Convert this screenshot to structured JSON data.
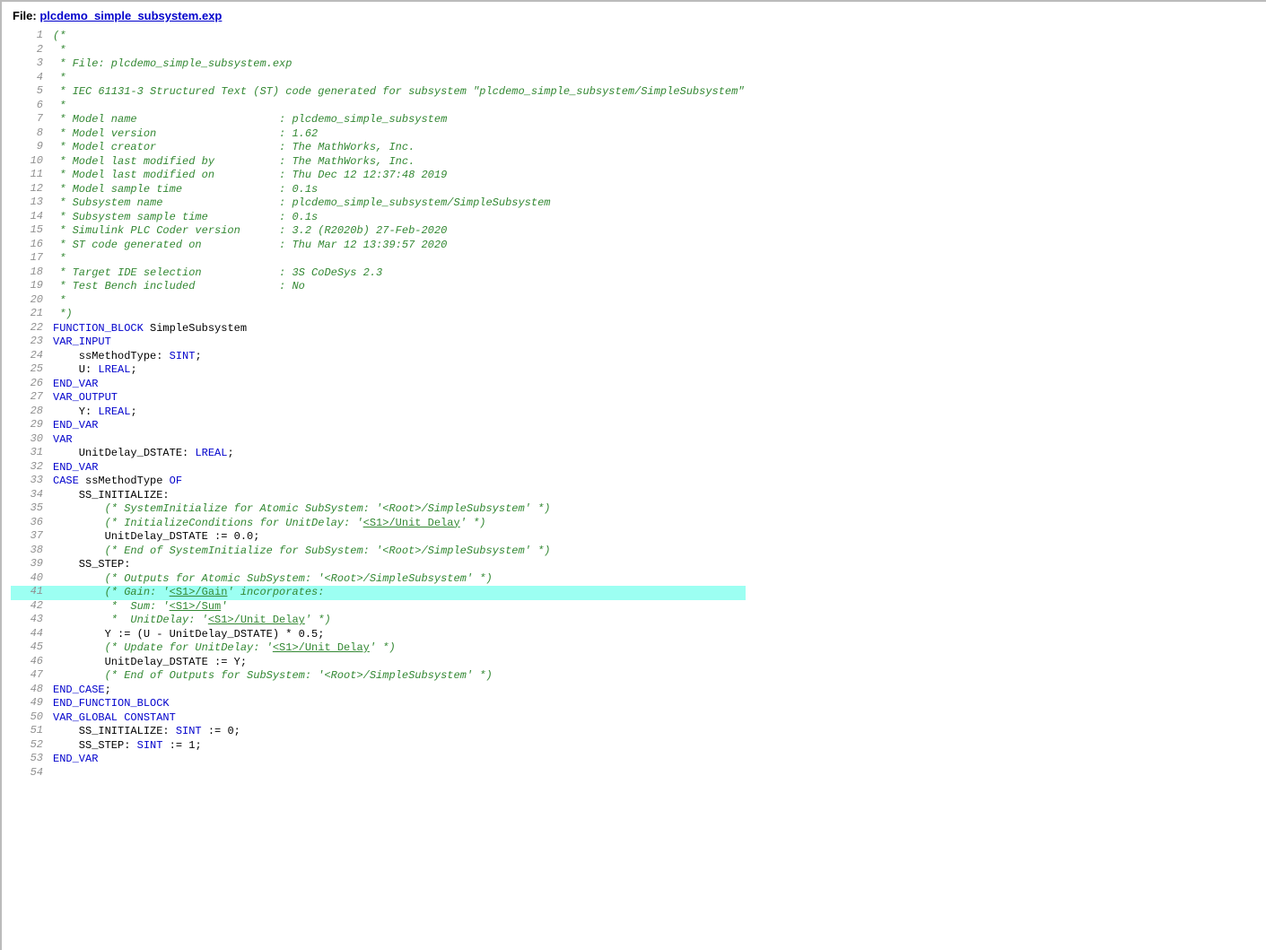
{
  "header": {
    "file_prefix": "File: ",
    "file_name": "plcdemo_simple_subsystem.exp"
  },
  "code": {
    "lines": [
      {
        "n": 1,
        "t": "comment",
        "txt": "(*"
      },
      {
        "n": 2,
        "t": "comment",
        "txt": " *"
      },
      {
        "n": 3,
        "t": "comment",
        "txt": " * File: plcdemo_simple_subsystem.exp"
      },
      {
        "n": 4,
        "t": "comment",
        "txt": " *"
      },
      {
        "n": 5,
        "t": "comment",
        "txt": " * IEC 61131-3 Structured Text (ST) code generated for subsystem \"plcdemo_simple_subsystem/SimpleSubsystem\""
      },
      {
        "n": 6,
        "t": "comment",
        "txt": " *"
      },
      {
        "n": 7,
        "t": "comment",
        "txt": " * Model name                      : plcdemo_simple_subsystem"
      },
      {
        "n": 8,
        "t": "comment",
        "txt": " * Model version                   : 1.62"
      },
      {
        "n": 9,
        "t": "comment",
        "txt": " * Model creator                   : The MathWorks, Inc."
      },
      {
        "n": 10,
        "t": "comment",
        "txt": " * Model last modified by          : The MathWorks, Inc."
      },
      {
        "n": 11,
        "t": "comment",
        "txt": " * Model last modified on          : Thu Dec 12 12:37:48 2019"
      },
      {
        "n": 12,
        "t": "comment",
        "txt": " * Model sample time               : 0.1s"
      },
      {
        "n": 13,
        "t": "comment",
        "txt": " * Subsystem name                  : plcdemo_simple_subsystem/SimpleSubsystem"
      },
      {
        "n": 14,
        "t": "comment",
        "txt": " * Subsystem sample time           : 0.1s"
      },
      {
        "n": 15,
        "t": "comment",
        "txt": " * Simulink PLC Coder version      : 3.2 (R2020b) 27-Feb-2020"
      },
      {
        "n": 16,
        "t": "comment",
        "txt": " * ST code generated on            : Thu Mar 12 13:39:57 2020"
      },
      {
        "n": 17,
        "t": "comment",
        "txt": " *"
      },
      {
        "n": 18,
        "t": "comment",
        "txt": " * Target IDE selection            : 3S CoDeSys 2.3"
      },
      {
        "n": 19,
        "t": "comment",
        "txt": " * Test Bench included             : No"
      },
      {
        "n": 20,
        "t": "comment",
        "txt": " *"
      },
      {
        "n": 21,
        "t": "comment",
        "txt": " *)"
      },
      {
        "n": 22,
        "t": "mixed",
        "parts": [
          {
            "cls": "keyword",
            "txt": "FUNCTION_BLOCK"
          },
          {
            "cls": "plain",
            "txt": " SimpleSubsystem"
          }
        ]
      },
      {
        "n": 23,
        "t": "keyword",
        "txt": "VAR_INPUT"
      },
      {
        "n": 24,
        "t": "mixed",
        "parts": [
          {
            "cls": "plain",
            "txt": "    ssMethodType: "
          },
          {
            "cls": "type",
            "txt": "SINT"
          },
          {
            "cls": "plain",
            "txt": ";"
          }
        ]
      },
      {
        "n": 25,
        "t": "mixed",
        "parts": [
          {
            "cls": "plain",
            "txt": "    U: "
          },
          {
            "cls": "type",
            "txt": "LREAL"
          },
          {
            "cls": "plain",
            "txt": ";"
          }
        ]
      },
      {
        "n": 26,
        "t": "keyword",
        "txt": "END_VAR"
      },
      {
        "n": 27,
        "t": "keyword",
        "txt": "VAR_OUTPUT"
      },
      {
        "n": 28,
        "t": "mixed",
        "parts": [
          {
            "cls": "plain",
            "txt": "    Y: "
          },
          {
            "cls": "type",
            "txt": "LREAL"
          },
          {
            "cls": "plain",
            "txt": ";"
          }
        ]
      },
      {
        "n": 29,
        "t": "keyword",
        "txt": "END_VAR"
      },
      {
        "n": 30,
        "t": "keyword",
        "txt": "VAR"
      },
      {
        "n": 31,
        "t": "mixed",
        "parts": [
          {
            "cls": "plain",
            "txt": "    UnitDelay_DSTATE: "
          },
          {
            "cls": "type",
            "txt": "LREAL"
          },
          {
            "cls": "plain",
            "txt": ";"
          }
        ]
      },
      {
        "n": 32,
        "t": "keyword",
        "txt": "END_VAR"
      },
      {
        "n": 33,
        "t": "mixed",
        "parts": [
          {
            "cls": "keyword",
            "txt": "CASE"
          },
          {
            "cls": "plain",
            "txt": " ssMethodType "
          },
          {
            "cls": "keyword",
            "txt": "OF"
          }
        ]
      },
      {
        "n": 34,
        "t": "plain",
        "txt": "    SS_INITIALIZE: "
      },
      {
        "n": 35,
        "t": "comment",
        "txt": "        (* SystemInitialize for Atomic SubSystem: '<Root>/SimpleSubsystem' *)"
      },
      {
        "n": 36,
        "t": "mixed",
        "parts": [
          {
            "cls": "comment",
            "txt": "        (* InitializeConditions for UnitDelay: '"
          },
          {
            "cls": "link",
            "txt": "<S1>/Unit Delay"
          },
          {
            "cls": "comment",
            "txt": "' *)"
          }
        ]
      },
      {
        "n": 37,
        "t": "plain",
        "txt": "        UnitDelay_DSTATE := 0.0;"
      },
      {
        "n": 38,
        "t": "comment",
        "txt": "        (* End of SystemInitialize for SubSystem: '<Root>/SimpleSubsystem' *)"
      },
      {
        "n": 39,
        "t": "plain",
        "txt": "    SS_STEP: "
      },
      {
        "n": 40,
        "t": "comment",
        "txt": "        (* Outputs for Atomic SubSystem: '<Root>/SimpleSubsystem' *)"
      },
      {
        "n": 41,
        "hl": true,
        "t": "mixed",
        "parts": [
          {
            "cls": "comment",
            "txt": "        (* Gain: '"
          },
          {
            "cls": "link",
            "txt": "<S1>/Gain"
          },
          {
            "cls": "comment",
            "txt": "' incorporates:"
          }
        ]
      },
      {
        "n": 42,
        "t": "mixed",
        "parts": [
          {
            "cls": "comment",
            "txt": "         *  Sum: '"
          },
          {
            "cls": "link",
            "txt": "<S1>/Sum"
          },
          {
            "cls": "comment",
            "txt": "'"
          }
        ]
      },
      {
        "n": 43,
        "t": "mixed",
        "parts": [
          {
            "cls": "comment",
            "txt": "         *  UnitDelay: '"
          },
          {
            "cls": "link",
            "txt": "<S1>/Unit Delay"
          },
          {
            "cls": "comment",
            "txt": "' *)"
          }
        ]
      },
      {
        "n": 44,
        "t": "plain",
        "txt": "        Y := (U - UnitDelay_DSTATE) * 0.5;"
      },
      {
        "n": 45,
        "t": "mixed",
        "parts": [
          {
            "cls": "comment",
            "txt": "        (* Update for UnitDelay: '"
          },
          {
            "cls": "link",
            "txt": "<S1>/Unit Delay"
          },
          {
            "cls": "comment",
            "txt": "' *)"
          }
        ]
      },
      {
        "n": 46,
        "t": "plain",
        "txt": "        UnitDelay_DSTATE := Y;"
      },
      {
        "n": 47,
        "t": "comment",
        "txt": "        (* End of Outputs for SubSystem: '<Root>/SimpleSubsystem' *)"
      },
      {
        "n": 48,
        "t": "mixed",
        "parts": [
          {
            "cls": "keyword",
            "txt": "END_CASE"
          },
          {
            "cls": "plain",
            "txt": ";"
          }
        ]
      },
      {
        "n": 49,
        "t": "keyword",
        "txt": "END_FUNCTION_BLOCK"
      },
      {
        "n": 50,
        "t": "keyword",
        "txt": "VAR_GLOBAL CONSTANT"
      },
      {
        "n": 51,
        "t": "mixed",
        "parts": [
          {
            "cls": "plain",
            "txt": "    SS_INITIALIZE: "
          },
          {
            "cls": "type",
            "txt": "SINT"
          },
          {
            "cls": "plain",
            "txt": " := 0;"
          }
        ]
      },
      {
        "n": 52,
        "t": "mixed",
        "parts": [
          {
            "cls": "plain",
            "txt": "    SS_STEP: "
          },
          {
            "cls": "type",
            "txt": "SINT"
          },
          {
            "cls": "plain",
            "txt": " := 1;"
          }
        ]
      },
      {
        "n": 53,
        "t": "keyword",
        "txt": "END_VAR"
      },
      {
        "n": 54,
        "t": "plain",
        "txt": ""
      }
    ]
  }
}
